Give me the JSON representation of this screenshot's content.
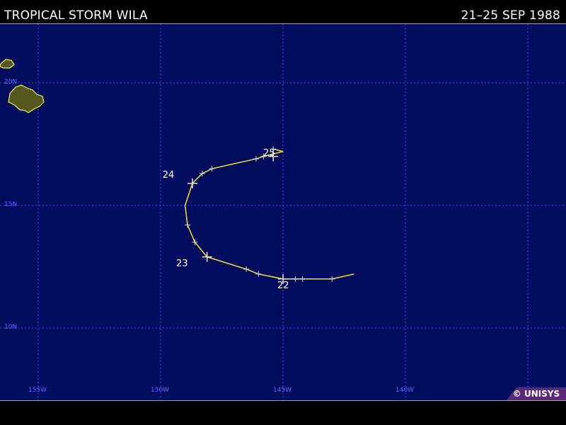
{
  "header": {
    "title": "TROPICAL STORM WILA",
    "dates": "21–25 SEP 1988"
  },
  "map": {
    "lat_labels": [
      "20N",
      "15N",
      "10N"
    ],
    "lon_labels": [
      "155W",
      "150W",
      "145W",
      "140W",
      "135W"
    ],
    "colors": {
      "ocean": "#000c5e",
      "grid": "#3c4cf0",
      "land": "#55581e",
      "coast": "#f2f24a",
      "track": "#e8d828",
      "marker": "#d9d9d9"
    },
    "land": "Hawaiian Islands",
    "credit": "© UNISYS"
  },
  "storm": {
    "name": "WILA",
    "day_labels": [
      {
        "day": "22",
        "lat": 12.0,
        "lon": -145.0
      },
      {
        "day": "23",
        "lat": 12.9,
        "lon": -148.9
      },
      {
        "day": "24",
        "lat": 16.1,
        "lon": -149.4
      },
      {
        "day": "25",
        "lat": 17.0,
        "lon": -145.4
      }
    ],
    "track": [
      {
        "lat": 12.2,
        "lon": -142.1
      },
      {
        "lat": 12.0,
        "lon": -143.0
      },
      {
        "lat": 12.0,
        "lon": -144.2
      },
      {
        "lat": 12.0,
        "lon": -144.5
      },
      {
        "lat": 12.0,
        "lon": -145.0
      },
      {
        "lat": 12.2,
        "lon": -146.0
      },
      {
        "lat": 12.4,
        "lon": -146.5
      },
      {
        "lat": 12.9,
        "lon": -148.1
      },
      {
        "lat": 13.5,
        "lon": -148.6
      },
      {
        "lat": 14.2,
        "lon": -148.9
      },
      {
        "lat": 15.0,
        "lon": -149.0
      },
      {
        "lat": 15.9,
        "lon": -148.7
      },
      {
        "lat": 16.3,
        "lon": -148.3
      },
      {
        "lat": 16.5,
        "lon": -147.9
      },
      {
        "lat": 16.9,
        "lon": -146.1
      },
      {
        "lat": 17.0,
        "lon": -145.8
      },
      {
        "lat": 17.2,
        "lon": -145.0
      },
      {
        "lat": 17.3,
        "lon": -145.4
      },
      {
        "lat": 17.0,
        "lon": -145.4
      }
    ],
    "tick_marks": [
      {
        "lat": 12.0,
        "lon": -143.0
      },
      {
        "lat": 12.0,
        "lon": -144.2
      },
      {
        "lat": 12.0,
        "lon": -144.5
      },
      {
        "lat": 12.2,
        "lon": -146.0
      },
      {
        "lat": 12.4,
        "lon": -146.5
      },
      {
        "lat": 13.5,
        "lon": -148.6
      },
      {
        "lat": 14.2,
        "lon": -148.9
      },
      {
        "lat": 16.3,
        "lon": -148.3
      },
      {
        "lat": 16.5,
        "lon": -147.9
      },
      {
        "lat": 16.9,
        "lon": -146.1
      },
      {
        "lat": 17.0,
        "lon": -145.8
      },
      {
        "lat": 17.3,
        "lon": -145.4
      }
    ],
    "day_crosses": [
      {
        "lat": 12.0,
        "lon": -145.0
      },
      {
        "lat": 12.9,
        "lon": -148.1
      },
      {
        "lat": 15.9,
        "lon": -148.7
      },
      {
        "lat": 17.0,
        "lon": -145.4
      }
    ]
  }
}
